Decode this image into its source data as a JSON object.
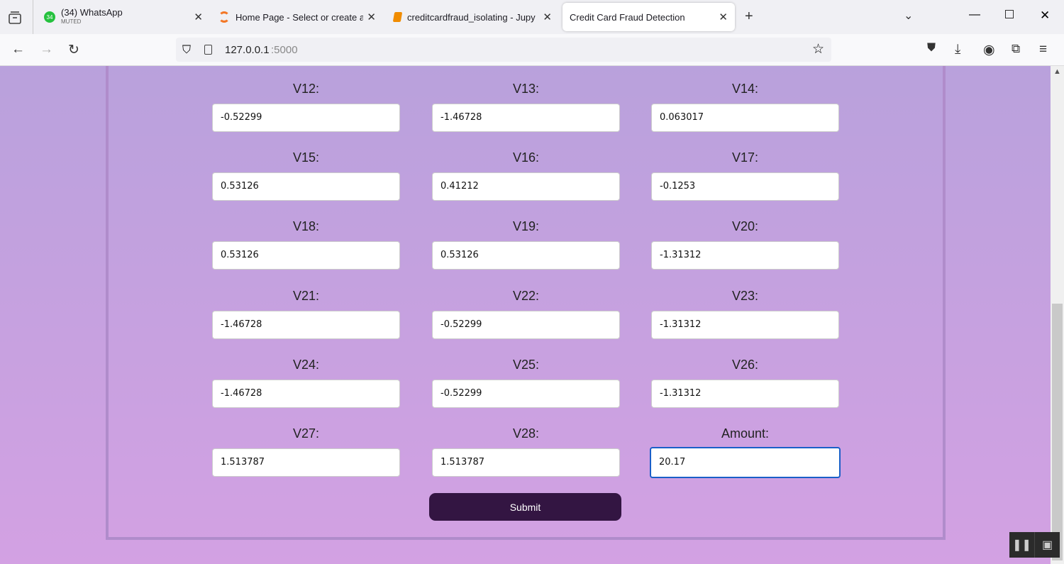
{
  "browser": {
    "tabs": [
      {
        "title": "(34) WhatsApp",
        "subtitle": "MUTED",
        "badge": "34"
      },
      {
        "title": "Home Page - Select or create a"
      },
      {
        "title": "creditcardfraud_isolating - Jupy"
      },
      {
        "title": "Credit Card Fraud Detection"
      }
    ],
    "new_tab": "+",
    "close": "✕",
    "url_host": "127.0.0.1",
    "url_port": ":5000"
  },
  "form": {
    "fields": [
      {
        "label": "V12:",
        "value": "-0.52299"
      },
      {
        "label": "V13:",
        "value": "-1.46728"
      },
      {
        "label": "V14:",
        "value": "0.063017"
      },
      {
        "label": "V15:",
        "value": "0.53126"
      },
      {
        "label": "V16:",
        "value": "0.41212"
      },
      {
        "label": "V17:",
        "value": "-0.1253"
      },
      {
        "label": "V18:",
        "value": "0.53126"
      },
      {
        "label": "V19:",
        "value": "0.53126"
      },
      {
        "label": "V20:",
        "value": "-1.31312"
      },
      {
        "label": "V21:",
        "value": "-1.46728"
      },
      {
        "label": "V22:",
        "value": "-0.52299"
      },
      {
        "label": "V23:",
        "value": "-1.31312"
      },
      {
        "label": "V24:",
        "value": "-1.46728"
      },
      {
        "label": "V25:",
        "value": "-0.52299"
      },
      {
        "label": "V26:",
        "value": "-1.31312"
      },
      {
        "label": "V27:",
        "value": "1.513787"
      },
      {
        "label": "V28:",
        "value": "1.513787"
      },
      {
        "label": "Amount:",
        "value": "20.17"
      }
    ],
    "submit_label": "Submit"
  }
}
